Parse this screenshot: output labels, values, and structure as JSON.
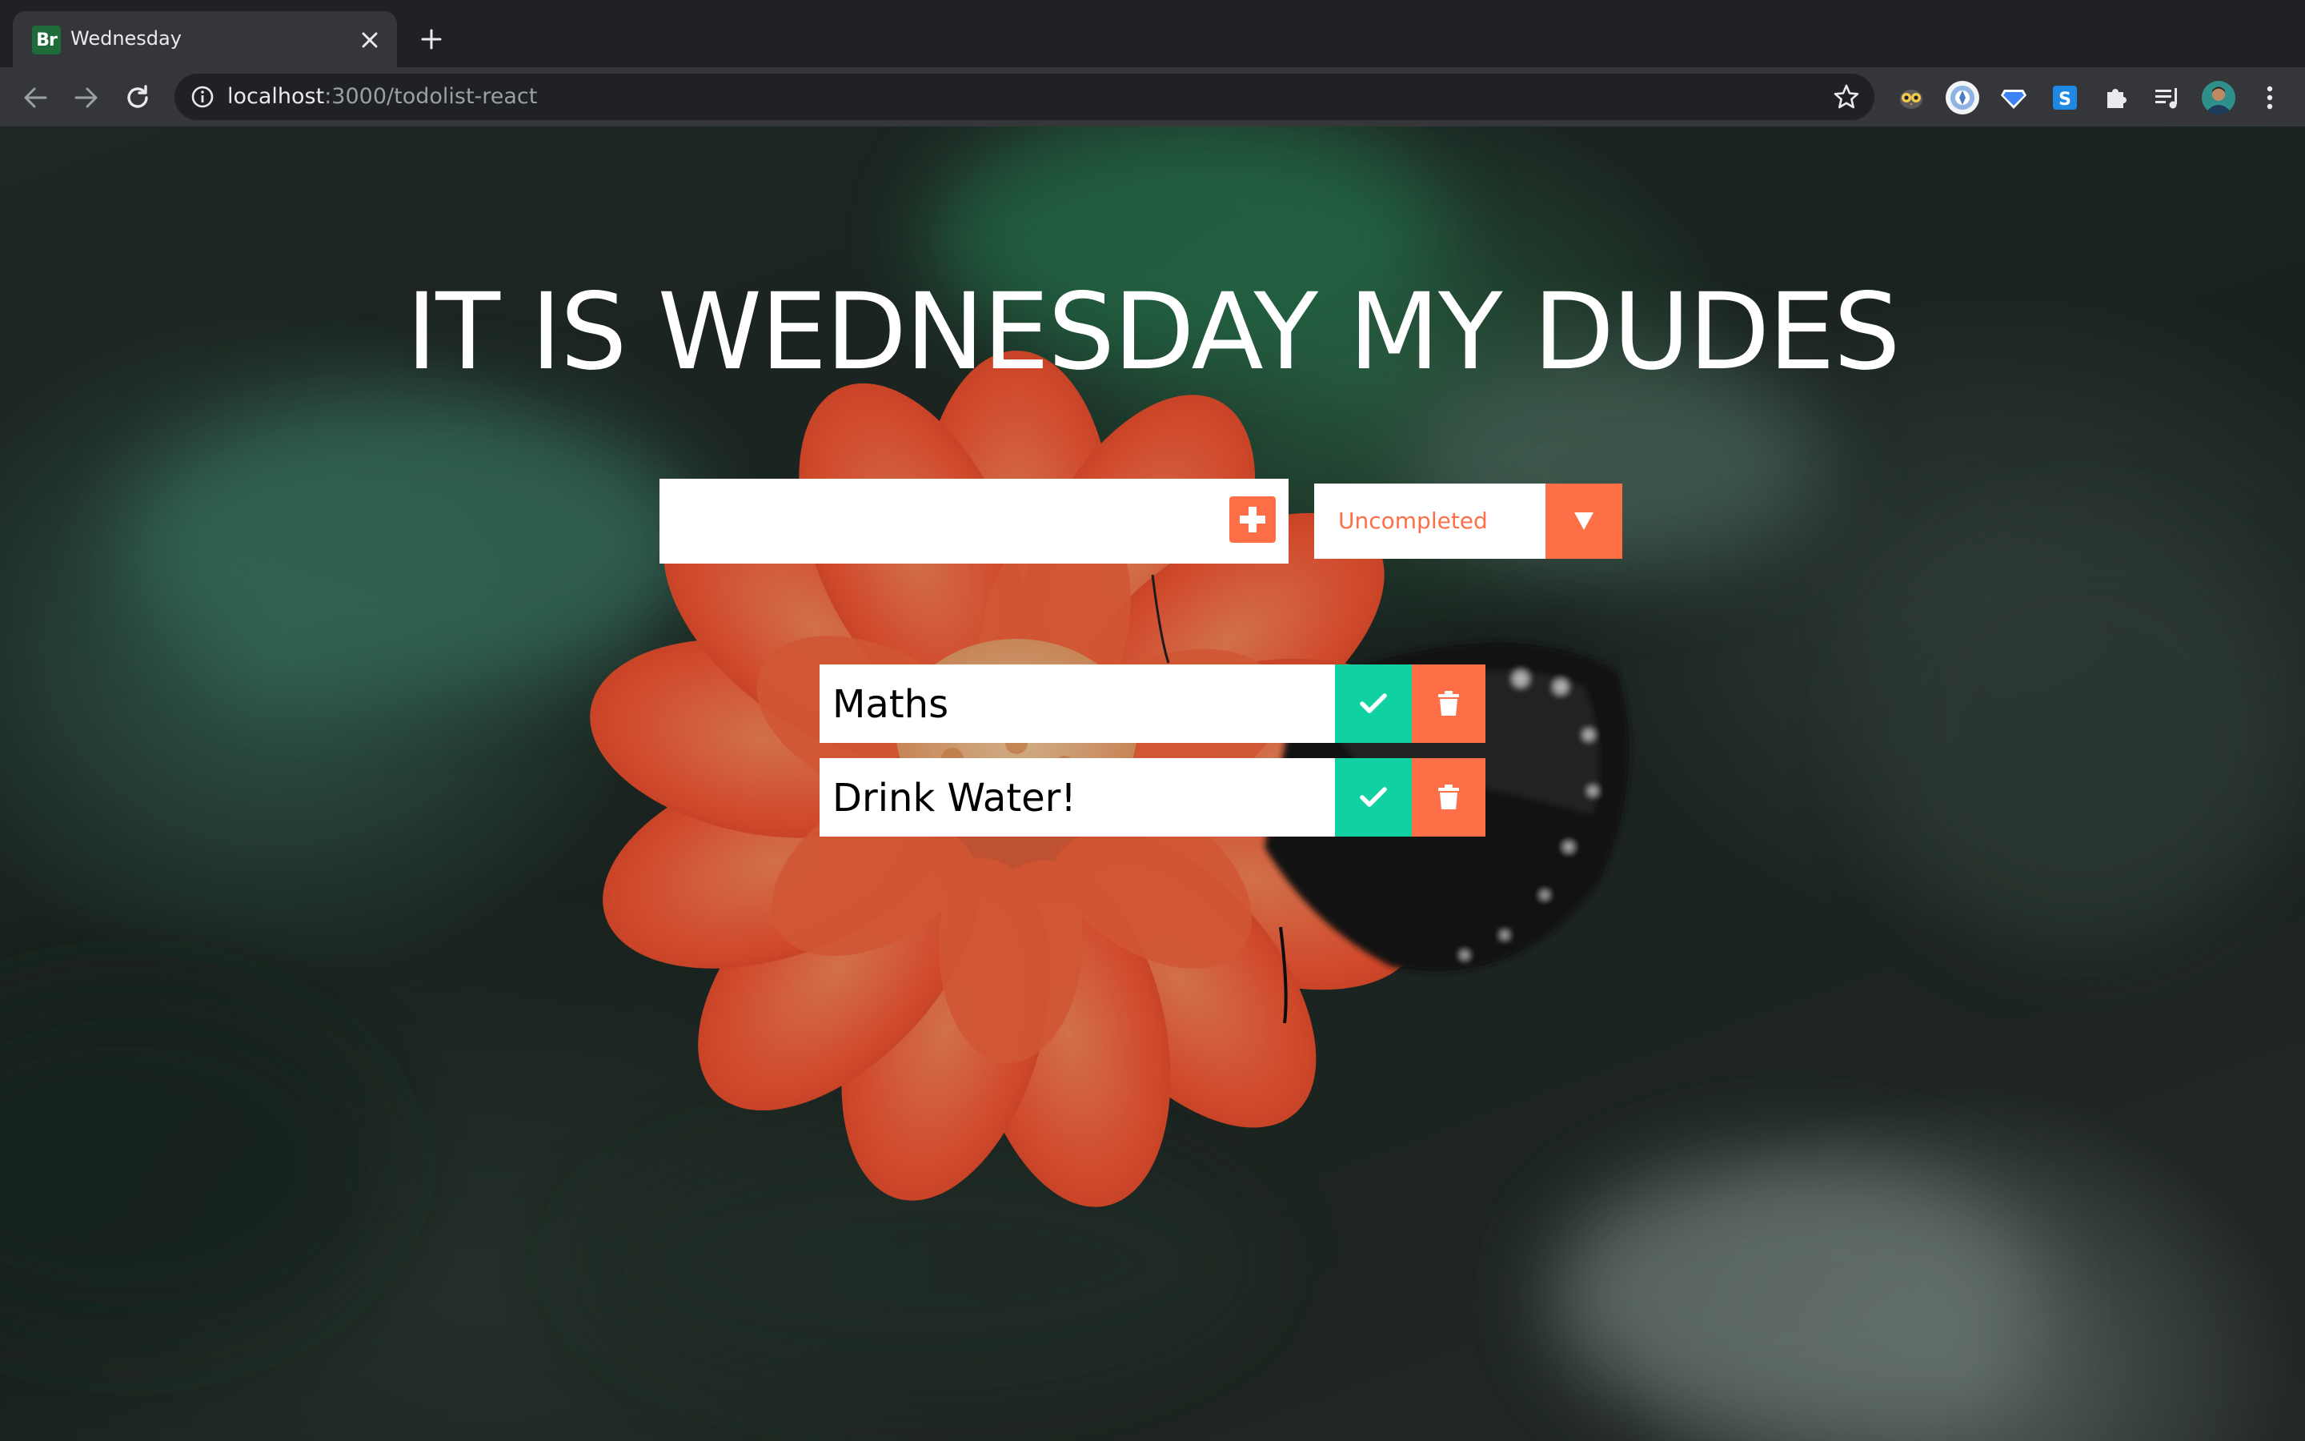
{
  "browser": {
    "tab": {
      "favicon_text": "Br",
      "title": "Wednesday"
    },
    "omnibox": {
      "host": "localhost",
      "path": ":3000/todolist-react"
    },
    "extension_icons": [
      "extension-owl-icon",
      "extension-circle-icon",
      "extension-diamond-icon",
      "extension-s-icon",
      "puzzle-icon",
      "media-queue-icon",
      "profile-avatar",
      "kebab-menu-icon"
    ]
  },
  "page": {
    "headline": "IT IS WEDNESDAY MY DUDES",
    "input": {
      "value": "",
      "placeholder": ""
    },
    "filter": {
      "selected": "Uncompleted"
    },
    "todos": [
      {
        "text": "Maths"
      },
      {
        "text": "Drink Water!"
      }
    ]
  },
  "colors": {
    "accent_orange": "#ff6f47",
    "complete_green": "#11d1a2",
    "chrome_dark": "#202124",
    "chrome_toolbar": "#35363a"
  }
}
